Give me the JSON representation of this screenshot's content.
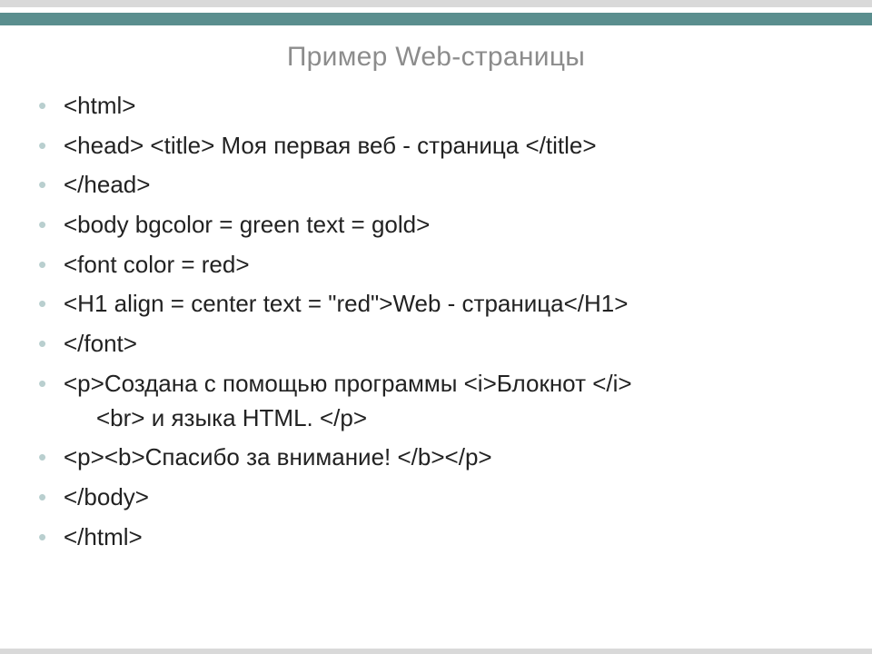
{
  "slide": {
    "title": "Пример Web-страницы",
    "bullets": {
      "b0": "<html>",
      "b1": "<head> <title> Моя первая веб - страница </title>",
      "b2": "</head>",
      "b3": "<body bgcolor = green text = gold>",
      "b4": "<font color = red>",
      "b5": "<H1 align = center text = \"red\">Web - страница</H1>",
      "b6": "</font>",
      "b7_line1": "<p>Создана с помощью программы <i>Блокнот </i>",
      "b7_line2": "<br> и языка HTML. </p>",
      "b8": "<p><b>Спасибо за внимание! </b></p>",
      "b9": "</body>",
      "b10": "</html>"
    }
  }
}
